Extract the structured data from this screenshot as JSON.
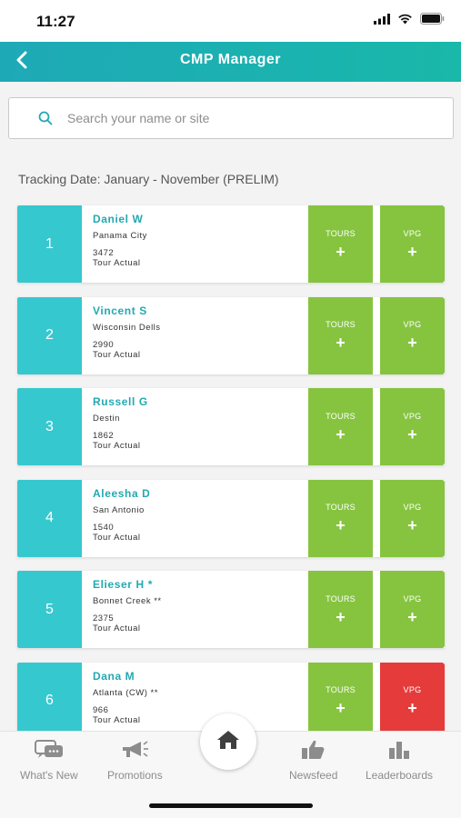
{
  "status_bar": {
    "time": "11:27"
  },
  "header": {
    "title": "CMP Manager"
  },
  "search": {
    "placeholder": "Search your name or site"
  },
  "tracking_date": "Tracking Date: January - November (PRELIM)",
  "buttons": {
    "tours": "TOURS",
    "vpg": "VPG",
    "plus": "+"
  },
  "entries": [
    {
      "rank": "1",
      "name": "Daniel W",
      "site": "Panama City",
      "count": "3472",
      "count_label": "Tour Actual",
      "vpg_color": "green"
    },
    {
      "rank": "2",
      "name": "Vincent S",
      "site": "Wisconsin Dells",
      "count": "2990",
      "count_label": "Tour Actual",
      "vpg_color": "green"
    },
    {
      "rank": "3",
      "name": "Russell G",
      "site": "Destin",
      "count": "1862",
      "count_label": "Tour Actual",
      "vpg_color": "green"
    },
    {
      "rank": "4",
      "name": "Aleesha D",
      "site": "San Antonio",
      "count": "1540",
      "count_label": "Tour Actual",
      "vpg_color": "green"
    },
    {
      "rank": "5",
      "name": "Elieser H *",
      "site": "Bonnet Creek **",
      "count": "2375",
      "count_label": "Tour Actual",
      "vpg_color": "green"
    },
    {
      "rank": "6",
      "name": "Dana M",
      "site": "Atlanta (CW) **",
      "count": "966",
      "count_label": "Tour Actual",
      "vpg_color": "red"
    }
  ],
  "tabs": {
    "whats_new": "What's New",
    "promotions": "Promotions",
    "newsfeed": "Newsfeed",
    "leaderboards": "Leaderboards"
  },
  "colors": {
    "header": "#1bb2b0",
    "rank_bg": "#36c8cf",
    "name_text": "#22a9b2",
    "green_button": "#86c440",
    "red_button": "#e63b3b"
  },
  "icons": {
    "back": "chevron-left-icon",
    "search": "search-icon",
    "whats_new": "chat-bubbles-icon",
    "promotions": "megaphone-icon",
    "home": "home-icon",
    "newsfeed": "thumbs-up-icon",
    "leaderboards": "bar-chart-icon"
  }
}
